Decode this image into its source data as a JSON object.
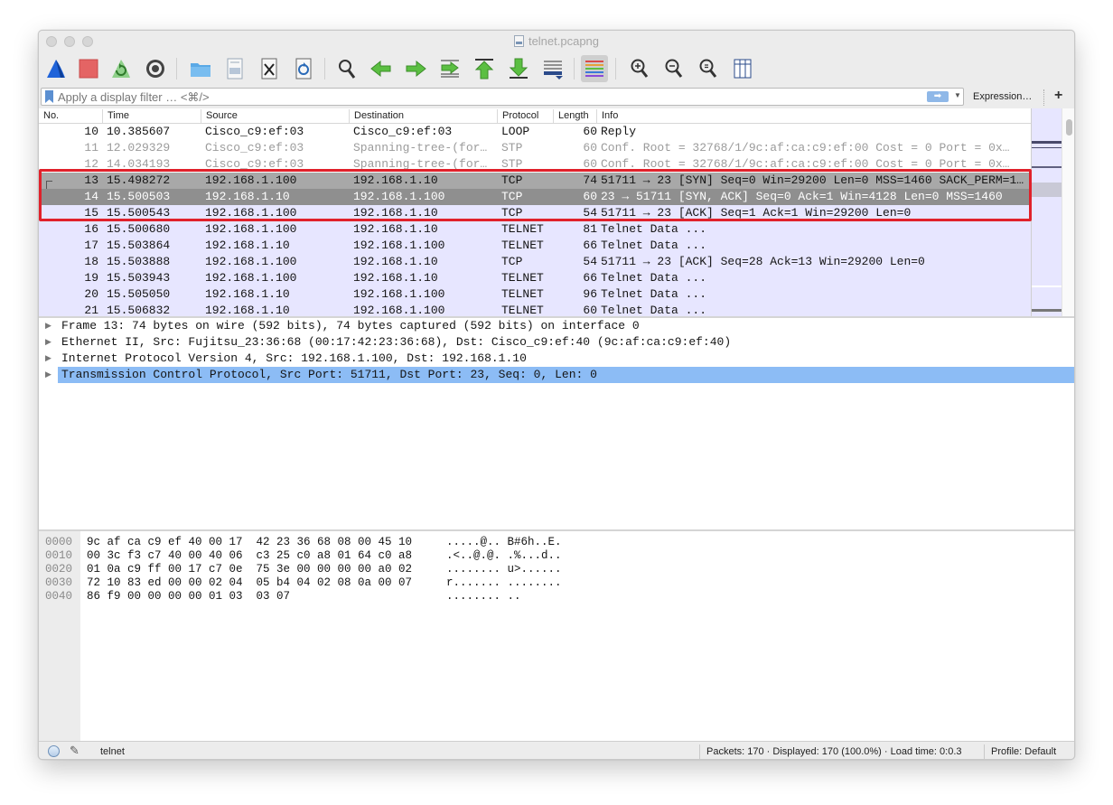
{
  "window": {
    "title": "telnet.pcapng"
  },
  "toolbar": {
    "buttons": [
      {
        "name": "start-capture-icon",
        "color": "#1f63d9"
      },
      {
        "name": "stop-capture-icon",
        "color": "#e04a4a"
      },
      {
        "name": "restart-capture-icon",
        "color": "#4ea84a"
      },
      {
        "name": "capture-options-icon",
        "color": "#333333"
      },
      {
        "name": "open-file-icon",
        "color": "#5aa9e6"
      },
      {
        "name": "save-file-icon",
        "color": "#7aa0c8"
      },
      {
        "name": "close-file-icon",
        "color": "#333333"
      },
      {
        "name": "reload-file-icon",
        "color": "#2a6ab8"
      },
      {
        "name": "find-packet-icon",
        "color": "#333333"
      },
      {
        "name": "go-back-icon",
        "color": "#54b23c"
      },
      {
        "name": "go-forward-icon",
        "color": "#54b23c"
      },
      {
        "name": "go-to-packet-icon",
        "color": "#54b23c"
      },
      {
        "name": "go-first-packet-icon",
        "color": "#54b23c"
      },
      {
        "name": "go-last-packet-icon",
        "color": "#54b23c"
      },
      {
        "name": "auto-scroll-icon",
        "color": "#2a4a8a"
      },
      {
        "name": "colorize-icon",
        "color": "#d94a4a"
      },
      {
        "name": "zoom-in-icon",
        "color": "#333333"
      },
      {
        "name": "zoom-out-icon",
        "color": "#333333"
      },
      {
        "name": "zoom-normal-icon",
        "color": "#333333"
      },
      {
        "name": "resize-columns-icon",
        "color": "#2a4a8a"
      }
    ]
  },
  "filter": {
    "placeholder": "Apply a display filter … <⌘/>",
    "value": "",
    "expression_label": "Expression…",
    "plus_label": "+"
  },
  "packet_list": {
    "columns": [
      "No.",
      "Time",
      "Source",
      "Destination",
      "Protocol",
      "Length",
      "Info"
    ],
    "rows": [
      {
        "no": "10",
        "time": "10.385607",
        "src": "Cisco_c9:ef:03",
        "dst": "Cisco_c9:ef:03",
        "proto": "LOOP",
        "len": "60",
        "info": "Reply",
        "style": "normal"
      },
      {
        "no": "11",
        "time": "12.029329",
        "src": "Cisco_c9:ef:03",
        "dst": "Spanning-tree-(for…",
        "proto": "STP",
        "len": "60",
        "info": "Conf. Root = 32768/1/9c:af:ca:c9:ef:00  Cost = 0  Port = 0x…",
        "style": "gray"
      },
      {
        "no": "12",
        "time": "14.034193",
        "src": "Cisco_c9:ef:03",
        "dst": "Spanning-tree-(for…",
        "proto": "STP",
        "len": "60",
        "info": "Conf. Root = 32768/1/9c:af:ca:c9:ef:00  Cost = 0  Port = 0x…",
        "style": "gray"
      },
      {
        "no": "13",
        "time": "15.498272",
        "src": "192.168.1.100",
        "dst": "192.168.1.10",
        "proto": "TCP",
        "len": "74",
        "info": "51711 → 23 [SYN] Seq=0 Win=29200 Len=0 MSS=1460 SACK_PERM=1…",
        "style": "sel-light"
      },
      {
        "no": "14",
        "time": "15.500503",
        "src": "192.168.1.10",
        "dst": "192.168.1.100",
        "proto": "TCP",
        "len": "60",
        "info": "23 → 51711 [SYN, ACK] Seq=0 Ack=1 Win=4128 Len=0 MSS=1460",
        "style": "sel-dark"
      },
      {
        "no": "15",
        "time": "15.500543",
        "src": "192.168.1.100",
        "dst": "192.168.1.10",
        "proto": "TCP",
        "len": "54",
        "info": "51711 → 23 [ACK] Seq=1 Ack=1 Win=29200 Len=0",
        "style": "tcp"
      },
      {
        "no": "16",
        "time": "15.500680",
        "src": "192.168.1.100",
        "dst": "192.168.1.10",
        "proto": "TELNET",
        "len": "81",
        "info": "Telnet Data ...",
        "style": "tcp"
      },
      {
        "no": "17",
        "time": "15.503864",
        "src": "192.168.1.10",
        "dst": "192.168.1.100",
        "proto": "TELNET",
        "len": "66",
        "info": "Telnet Data ...",
        "style": "tcp"
      },
      {
        "no": "18",
        "time": "15.503888",
        "src": "192.168.1.100",
        "dst": "192.168.1.10",
        "proto": "TCP",
        "len": "54",
        "info": "51711 → 23 [ACK] Seq=28 Ack=13 Win=29200 Len=0",
        "style": "tcp"
      },
      {
        "no": "19",
        "time": "15.503943",
        "src": "192.168.1.100",
        "dst": "192.168.1.10",
        "proto": "TELNET",
        "len": "66",
        "info": "Telnet Data ...",
        "style": "tcp"
      },
      {
        "no": "20",
        "time": "15.505050",
        "src": "192.168.1.10",
        "dst": "192.168.1.100",
        "proto": "TELNET",
        "len": "96",
        "info": "Telnet Data ...",
        "style": "tcp"
      },
      {
        "no": "21",
        "time": "15.506832",
        "src": "192.168.1.10",
        "dst": "192.168.1.100",
        "proto": "TELNET",
        "len": "60",
        "info": "Telnet Data ...",
        "style": "tcp"
      }
    ]
  },
  "details": {
    "items": [
      {
        "text": "Frame 13: 74 bytes on wire (592 bits), 74 bytes captured (592 bits) on interface 0",
        "selected": false
      },
      {
        "text": "Ethernet II, Src: Fujitsu_23:36:68 (00:17:42:23:36:68), Dst: Cisco_c9:ef:40 (9c:af:ca:c9:ef:40)",
        "selected": false
      },
      {
        "text": "Internet Protocol Version 4, Src: 192.168.1.100, Dst: 192.168.1.10",
        "selected": false
      },
      {
        "text": "Transmission Control Protocol, Src Port: 51711, Dst Port: 23, Seq: 0, Len: 0",
        "selected": true
      }
    ]
  },
  "bytes": {
    "rows": [
      {
        "offset": "0000",
        "hex": "9c af ca c9 ef 40 00 17  42 23 36 68 08 00 45 10",
        "ascii": ".....@.. B#6h..E."
      },
      {
        "offset": "0010",
        "hex": "00 3c f3 c7 40 00 40 06  c3 25 c0 a8 01 64 c0 a8",
        "ascii": ".<..@.@. .%...d.."
      },
      {
        "offset": "0020",
        "hex": "01 0a c9 ff 00 17 c7 0e  75 3e 00 00 00 00 a0 02",
        "ascii": "........ u>......"
      },
      {
        "offset": "0030",
        "hex": "72 10 83 ed 00 00 02 04  05 b4 04 02 08 0a 00 07",
        "ascii": "r....... ........"
      },
      {
        "offset": "0040",
        "hex": "86 f9 00 00 00 00 01 03  03 07",
        "ascii": "........ .."
      }
    ]
  },
  "status": {
    "file": "telnet",
    "packets": "Packets: 170 · Displayed: 170 (100.0%) · Load time: 0:0.3",
    "profile": "Profile: Default"
  },
  "colors": {
    "tcp_row": "#e7e6ff",
    "selected_detail": "#8cbcf5",
    "annotation_box": "#e0212b"
  }
}
